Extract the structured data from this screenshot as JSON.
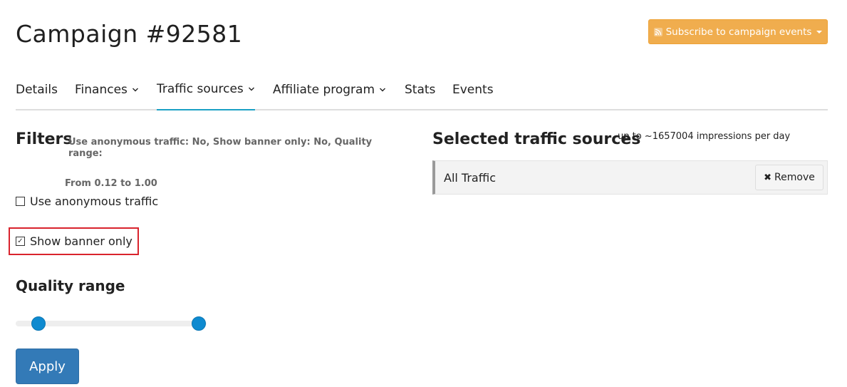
{
  "page": {
    "title": "Campaign #92581"
  },
  "subscribe": {
    "label": "Subscribe to campaign events",
    "icon": "rss-icon",
    "color": "#f0ad4e"
  },
  "tabs": [
    {
      "label": "Details",
      "dropdown": false
    },
    {
      "label": "Finances",
      "dropdown": true
    },
    {
      "label": "Traffic sources",
      "dropdown": true,
      "active": true
    },
    {
      "label": "Affiliate program",
      "dropdown": true
    },
    {
      "label": "Stats",
      "dropdown": false
    },
    {
      "label": "Events",
      "dropdown": false
    }
  ],
  "filters": {
    "heading": "Filters",
    "summary_line1": "Use anonymous traffic: No, Show banner only: No, Quality range:",
    "summary_line2": "From 0.12 to 1.00",
    "anonymous": {
      "label": "Use anonymous traffic",
      "checked": false
    },
    "banner_only": {
      "label": "Show banner only",
      "checked": true
    }
  },
  "quality": {
    "heading": "Quality range",
    "min": 0.12,
    "max": 1.0,
    "accent": "#0e8ad0"
  },
  "apply": {
    "label": "Apply",
    "color": "#337ab7"
  },
  "sources": {
    "heading": "Selected traffic sources",
    "note": "up to ~1657004 impressions per day",
    "items": [
      {
        "name": "All Traffic",
        "remove_label": "Remove"
      }
    ]
  }
}
